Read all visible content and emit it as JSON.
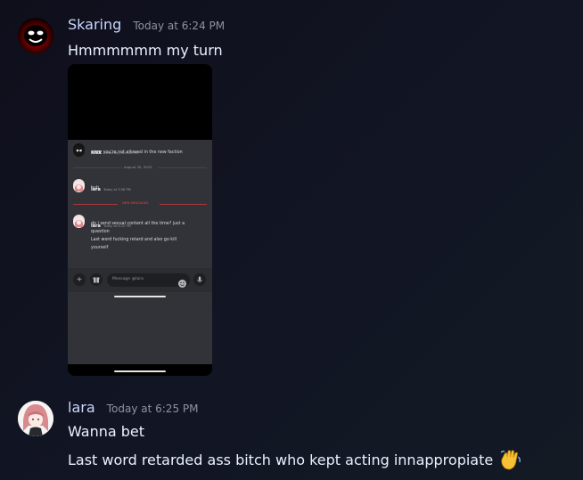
{
  "messages": [
    {
      "username": "Skaring",
      "timestamp": "Today at 6:24 PM",
      "lines": [
        "Hmmmmmm my turn"
      ],
      "attachment": {
        "messages": [
          {
            "name": "KNX",
            "time": "Yesterday at 8:22 PM",
            "lines": [
              "sorry you're not allowed in the new faction"
            ]
          },
          {
            "name": "lara",
            "time": "Today at 3:56 PM",
            "lines": [
              "huh"
            ]
          },
          {
            "name": "lara",
            "time": "Today at 6:22 PM",
            "lines": [
              "do i send sexual content all the time? just a",
              "question",
              "Last word fucking retard and also go kill",
              "yourself"
            ]
          }
        ],
        "date_divider": "August 30, 2023",
        "new_divider": "NEW MESSAGES",
        "composer_placeholder": "Message @lara"
      }
    },
    {
      "username": "lara",
      "timestamp": "Today at 6:25 PM",
      "lines": [
        "Wanna bet",
        "Last word retarded ass bitch who kept acting innappropiate"
      ],
      "emoji": "waving-hand"
    }
  ],
  "colors": {
    "username": "#c9d7ff",
    "timestamp": "#8d949f",
    "text": "#eaf2ff",
    "new_messages": "#f23f43"
  }
}
